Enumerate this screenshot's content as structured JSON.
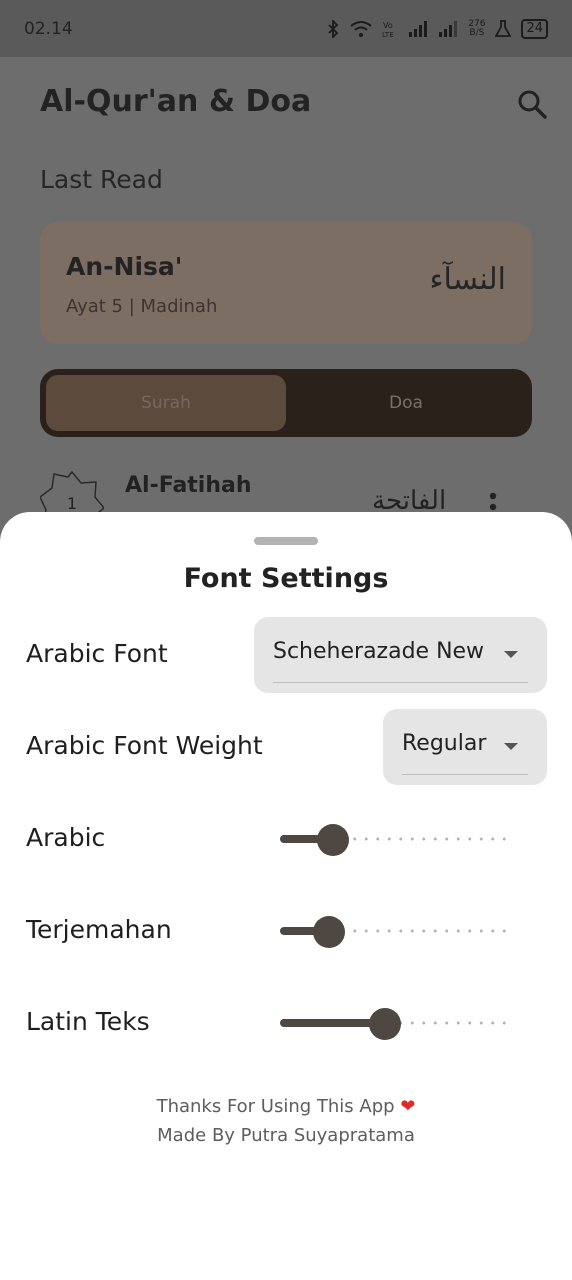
{
  "status_bar": {
    "time": "02.14",
    "network_speed_top": "276",
    "network_speed_bottom": "B/S",
    "battery": "24",
    "icons": [
      "bluetooth-icon",
      "wifi-icon",
      "volte-icon",
      "signal-icon",
      "signal-icon",
      "data-speed",
      "flask-icon",
      "battery-icon"
    ]
  },
  "app": {
    "title": "Al-Qur'an & Doa",
    "last_read_label": "Last Read",
    "last_read": {
      "surah": "An-Nisa'",
      "meta": "Ayat 5 | Madinah",
      "arabic": "النسآء"
    },
    "tabs": [
      {
        "label": "Surah",
        "selected": true
      },
      {
        "label": "Doa",
        "selected": false
      }
    ],
    "surah_list": [
      {
        "number": "1",
        "name": "Al-Fatihah",
        "arabic": "الفاتحة"
      }
    ]
  },
  "font_settings": {
    "title": "Font Settings",
    "arabic_font": {
      "label": "Arabic Font",
      "value": "Scheherazade New"
    },
    "arabic_font_weight": {
      "label": "Arabic Font Weight",
      "value": "Regular"
    },
    "sliders": [
      {
        "label": "Arabic",
        "value": 0.15
      },
      {
        "label": "Terjemahan",
        "value": 0.135
      },
      {
        "label": "Latin Teks",
        "value": 0.38
      }
    ],
    "footer": {
      "line1": "Thanks For Using This App",
      "line2": "Made By Putra Suyapratama"
    }
  },
  "colors": {
    "accent": "#4f4741",
    "sheet_background": "#ffffff",
    "dropdown_background": "#e5e5e5",
    "heart": "#e02b2b"
  }
}
